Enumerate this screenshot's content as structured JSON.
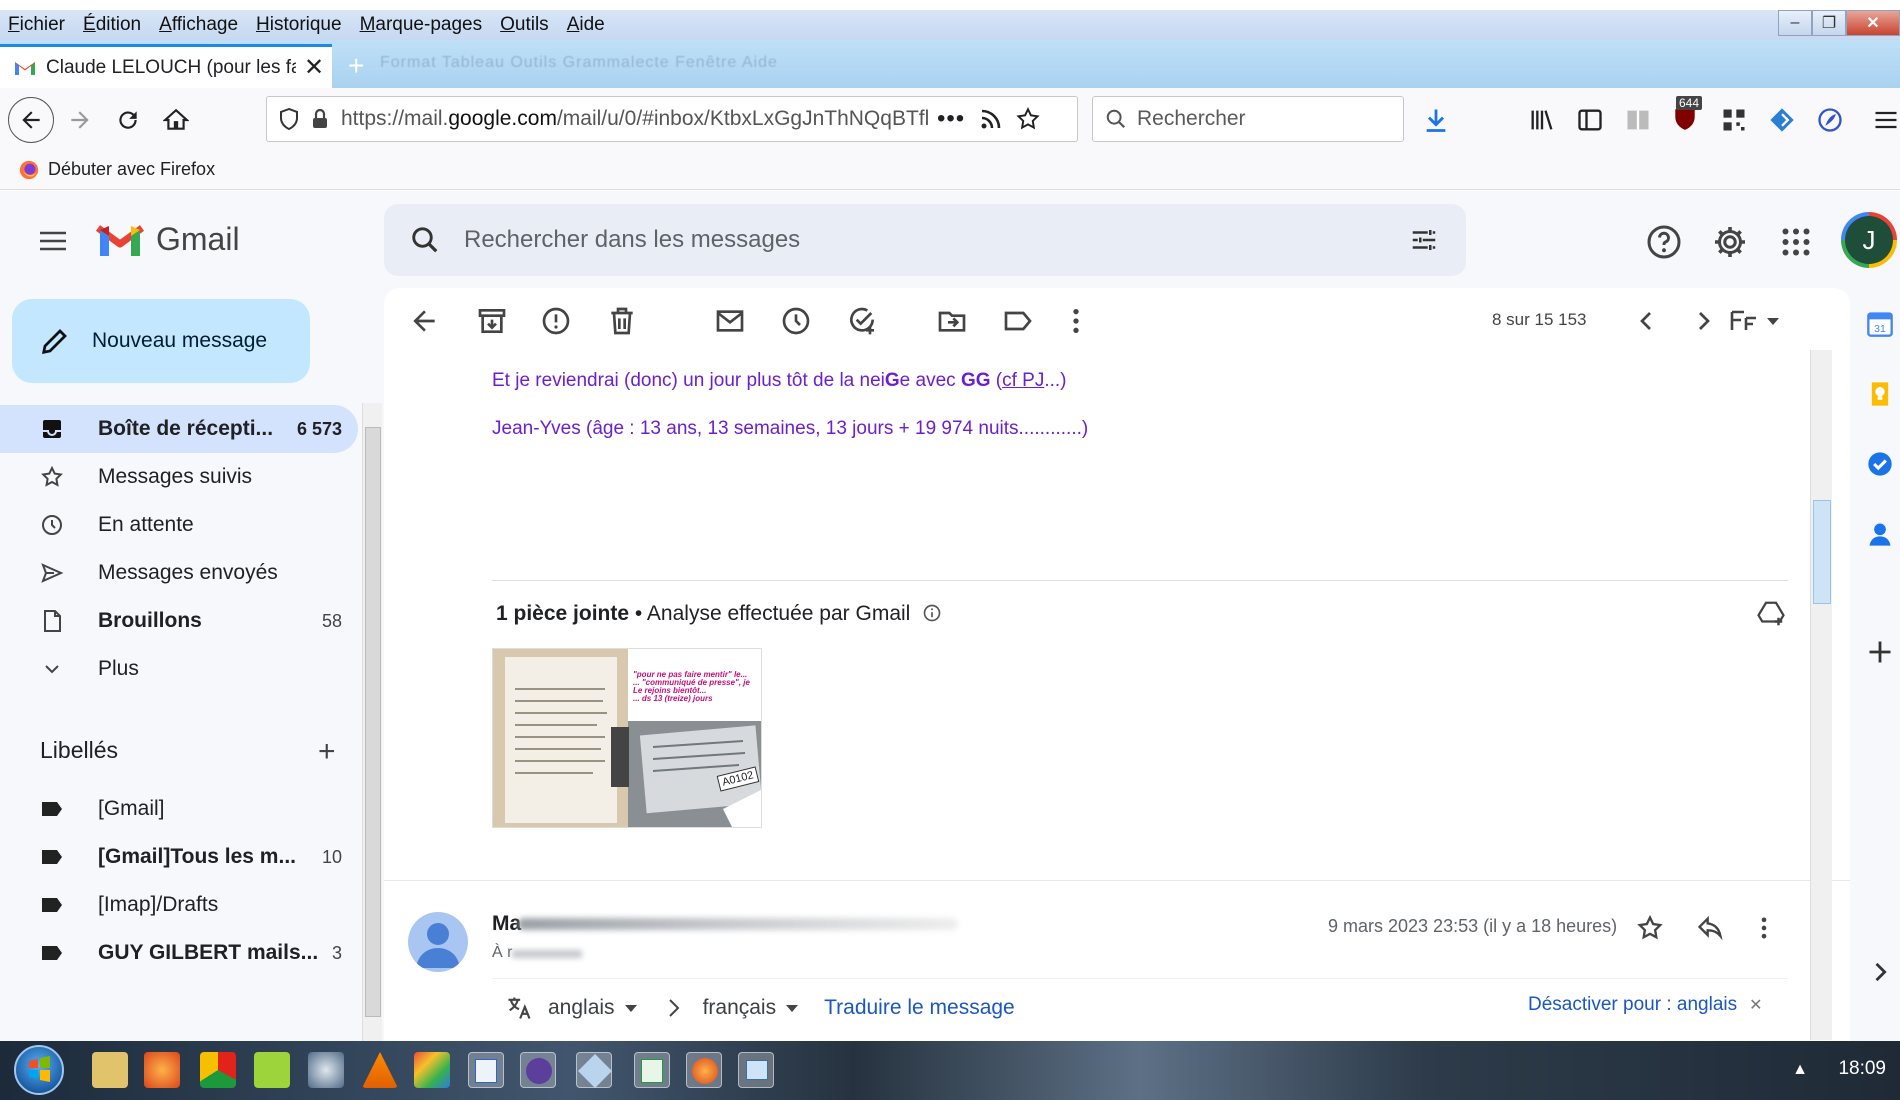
{
  "browser": {
    "menu": [
      {
        "label": "Fichier",
        "u": "F",
        "rest": "ichier"
      },
      {
        "label": "Édition",
        "u": "É",
        "rest": "dition"
      },
      {
        "label": "Affichage",
        "u": "A",
        "rest": "ffichage"
      },
      {
        "label": "Historique",
        "u": "H",
        "rest": "istorique"
      },
      {
        "label": "Marque-pages",
        "u": "M",
        "rest": "arque-pages"
      },
      {
        "label": "Outils",
        "u": "O",
        "rest": "utils"
      },
      {
        "label": "Aide",
        "u": "A",
        "rest": "ide"
      }
    ],
    "tab_title": "Claude LELOUCH (pour les fans",
    "ghost_menu": "Format   Tableau   Outils   Grammalecte   Fenêtre   Aide",
    "url_prefix": "https://mail.",
    "url_domain": "google.com",
    "url_rest": "/mail/u/0/#inbox/KtbxLxGgJnThNQqBTfl",
    "search_placeholder": "Rechercher",
    "ublock_badge": "644",
    "bookmark": "Débuter avec Firefox"
  },
  "gmail": {
    "logo_text": "Gmail",
    "search_placeholder": "Rechercher dans les messages",
    "avatar_letter": "J",
    "compose_label": "Nouveau message",
    "nav": [
      {
        "label": "Boîte de récepti...",
        "count": "6 573",
        "icon": "inbox-icon"
      },
      {
        "label": "Messages suivis",
        "count": "",
        "icon": "star-icon"
      },
      {
        "label": "En attente",
        "count": "",
        "icon": "clock-icon"
      },
      {
        "label": "Messages envoyés",
        "count": "",
        "icon": "send-icon"
      },
      {
        "label": "Brouillons",
        "count": "58",
        "icon": "draft-icon"
      },
      {
        "label": "Plus",
        "count": "",
        "icon": "chevron-down-icon"
      }
    ],
    "labels_heading": "Libellés",
    "labels": [
      {
        "label": "[Gmail]",
        "count": ""
      },
      {
        "label": "[Gmail]Tous les m...",
        "count": "10"
      },
      {
        "label": "[Imap]/Drafts",
        "count": ""
      },
      {
        "label": "GUY GILBERT mails...",
        "count": "3"
      }
    ],
    "pager": "8 sur 15 153",
    "message": {
      "line1_a": "Et je reviendrai (donc) un jour plus tôt de la nei",
      "line1_b": "G",
      "line1_c": "e avec ",
      "line1_d": "GG",
      "line1_e": " (",
      "line1_f": "cf PJ",
      "line1_g": "...)",
      "line2": "Jean-Yves (âge : 13 ans, 13 semaines, 13 jours + 19 974 nuits............)"
    },
    "attachments": {
      "count_label": "1 pièce jointe",
      "scan_label": " • Analyse effectuée par Gmail",
      "thumb_caption_1": "\"pour ne pas faire mentir\" le...",
      "thumb_caption_2": "... \"communiqué de presse\", je",
      "thumb_caption_3": "Le rejoins bientôt...",
      "thumb_caption_4": "... ds 13 (treize) jours",
      "thumb_tag": "A0102"
    },
    "next_message": {
      "sender_initial": "Ma",
      "to_prefix": "À r",
      "date": "9 mars 2023 23:53 (il y a 18 heures)"
    },
    "translate": {
      "from": "anglais",
      "to": "français",
      "action": "Traduire le message",
      "disable": "Désactiver pour : anglais"
    }
  },
  "taskbar": {
    "clock": "18:09"
  }
}
